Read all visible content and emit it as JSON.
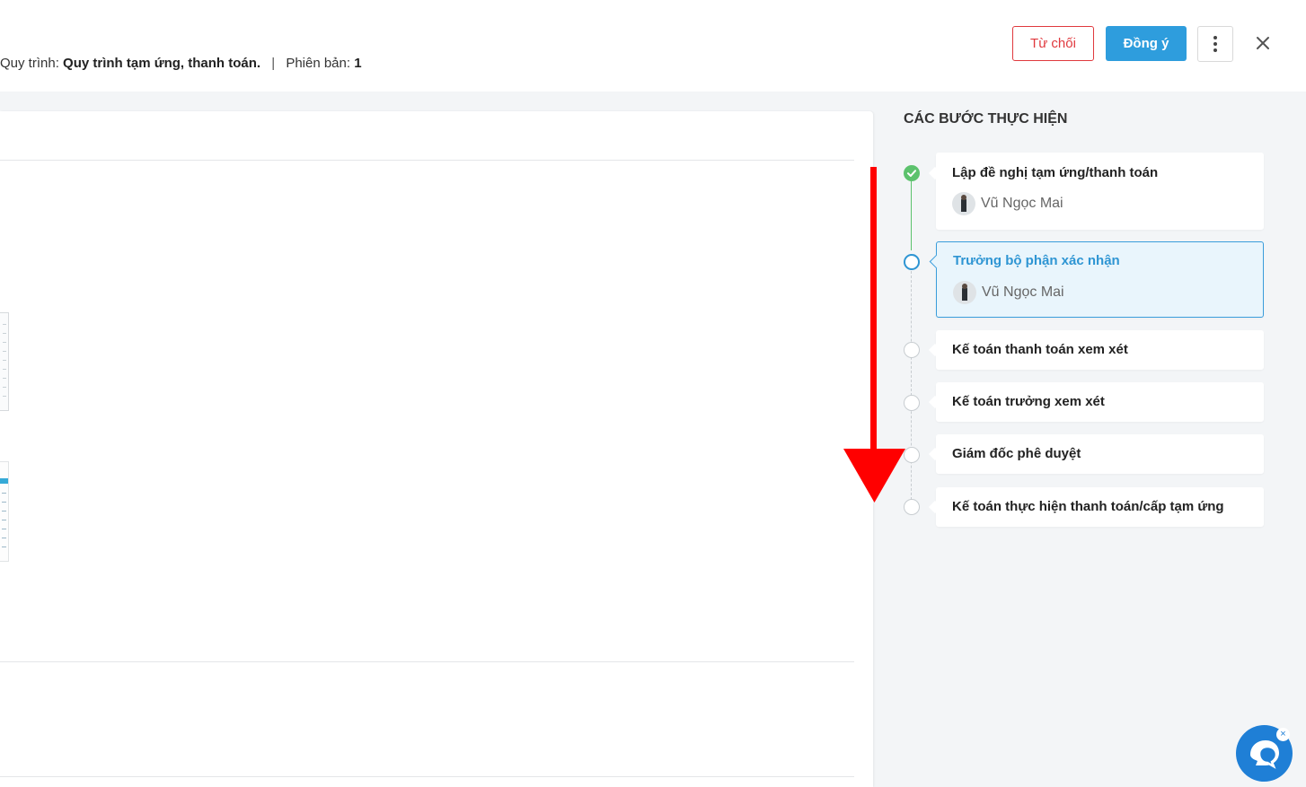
{
  "header": {
    "process_label": "Quy trình:",
    "process_name": "Quy trình tạm ứng, thanh toán.",
    "separator": "|",
    "version_label": "Phiên bản:",
    "version_value": "1",
    "reject_label": "Từ chối",
    "accept_label": "Đồng ý"
  },
  "steps": {
    "title": "CÁC BƯỚC THỰC HIỆN",
    "items": [
      {
        "name": "Lập đề nghị tạm ứng/thanh toán",
        "assignee": "Vũ Ngọc Mai",
        "status": "done"
      },
      {
        "name": "Trưởng bộ phận xác nhận",
        "assignee": "Vũ Ngọc Mai",
        "status": "current"
      },
      {
        "name": "Kế toán thanh toán xem xét",
        "status": "pending"
      },
      {
        "name": "Kế toán trưởng xem xét",
        "status": "pending"
      },
      {
        "name": "Giám đốc phê duyệt",
        "status": "pending"
      },
      {
        "name": "Kế toán thực hiện thanh toán/cấp tạm ứng",
        "status": "pending"
      }
    ]
  },
  "colors": {
    "accent": "#2e9ddd",
    "reject": "#e0393e",
    "done": "#5cc26d",
    "annotation_arrow": "#ff0000"
  },
  "chat": {
    "close_label": "×"
  }
}
